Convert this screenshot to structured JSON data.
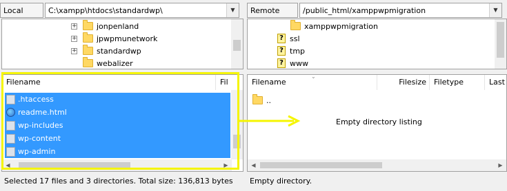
{
  "local": {
    "site_label": "Local site:",
    "site_path": "C:\\xampp\\htdocs\\standardwp\\",
    "tree": [
      {
        "label": "jonpenland",
        "expandable": "+"
      },
      {
        "label": "jpwpmunetwork",
        "expandable": "+"
      },
      {
        "label": "standardwp",
        "expandable": "+"
      },
      {
        "label": "webalizer",
        "expandable": ""
      }
    ],
    "columns": {
      "filename": "Filename",
      "filesize": "Fil"
    },
    "files": [
      {
        "name": ".htaccess",
        "icon": "file-icon"
      },
      {
        "name": "readme.html",
        "icon": "globe-icon"
      },
      {
        "name": "wp-includes",
        "icon": "folder-icon"
      },
      {
        "name": "wp-content",
        "icon": "folder-icon"
      },
      {
        "name": "wp-admin",
        "icon": "folder-icon"
      }
    ],
    "status": "Selected 17 files and 3 directories. Total size: 136,813 bytes"
  },
  "remote": {
    "site_label": "Remote site:",
    "site_path": "/public_html/xamppwpmigration",
    "tree": [
      {
        "label": "xamppwpmigration",
        "icon": "folder-icon"
      },
      {
        "label": "ssl",
        "icon": "unknown-icon"
      },
      {
        "label": "tmp",
        "icon": "unknown-icon"
      },
      {
        "label": "www",
        "icon": "unknown-icon"
      }
    ],
    "columns": {
      "filename": "Filename",
      "filesize": "Filesize",
      "filetype": "Filetype",
      "last": "Last"
    },
    "parent_dir": "..",
    "empty_text": "Empty directory listing",
    "status": "Empty directory."
  },
  "colors": {
    "selection": "#3399ff",
    "annotation": "#f5f500"
  }
}
